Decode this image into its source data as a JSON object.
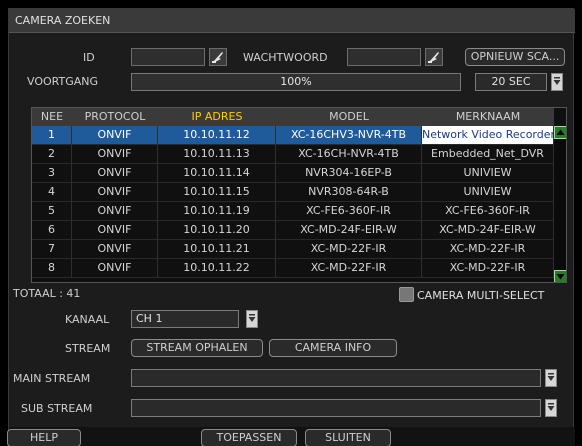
{
  "dialog": {
    "title": "CAMERA ZOEKEN"
  },
  "login": {
    "id_label": "ID",
    "id_value": "",
    "password_label": "WACHTWOORD",
    "password_value": "",
    "rescan_label": "OPNIEUW SCA..."
  },
  "progress": {
    "label": "VOORTGANG",
    "text": "100%",
    "value_percent": 100,
    "timeout_value": "20 SEC"
  },
  "table": {
    "headers": [
      "NEE",
      "PROTOCOL",
      "IP ADRES",
      "MODEL",
      "MERKNAAM"
    ],
    "highlight_header": "IP ADRES",
    "rows": [
      [
        "1",
        "ONVIF",
        "10.10.11.12",
        "XC-16CHV3-NVR-4TB",
        "Network Video Recorder"
      ],
      [
        "2",
        "ONVIF",
        "10.10.11.13",
        "XC-16CH-NVR-4TB",
        "Embedded_Net_DVR"
      ],
      [
        "3",
        "ONVIF",
        "10.10.11.14",
        "NVR304-16EP-B",
        "UNIVIEW"
      ],
      [
        "4",
        "ONVIF",
        "10.10.11.15",
        "NVR308-64R-B",
        "UNIVIEW"
      ],
      [
        "5",
        "ONVIF",
        "10.10.11.19",
        "XC-FE6-360F-IR",
        "XC-FE6-360F-IR"
      ],
      [
        "6",
        "ONVIF",
        "10.10.11.20",
        "XC-MD-24F-EIR-W",
        "XC-MD-24F-EIR-W"
      ],
      [
        "7",
        "ONVIF",
        "10.10.11.21",
        "XC-MD-22F-IR",
        "XC-MD-22F-IR"
      ],
      [
        "8",
        "ONVIF",
        "10.10.11.22",
        "XC-MD-22F-IR",
        "XC-MD-22F-IR"
      ]
    ],
    "selected_row": 0
  },
  "summary": {
    "total": "TOTAAL : 41",
    "multi_select_label": "CAMERA MULTI-SELECT",
    "multi_select_checked": false
  },
  "channel": {
    "label": "KANAAL",
    "value": "CH 1"
  },
  "stream": {
    "label": "STREAM",
    "fetch_label": "STREAM OPHALEN",
    "info_label": "CAMERA INFO",
    "main_label": "MAIN STREAM",
    "main_value": "",
    "sub_label": "SUB STREAM",
    "sub_value": ""
  },
  "footer": {
    "help_label": "HELP",
    "apply_label": "TOEPASSEN",
    "close_label": "SLUITEN"
  },
  "colors": {
    "selected_row": "#1f5a9a",
    "header_highlight": "#ffcc00",
    "scroll_button": "#2b7a2b"
  }
}
